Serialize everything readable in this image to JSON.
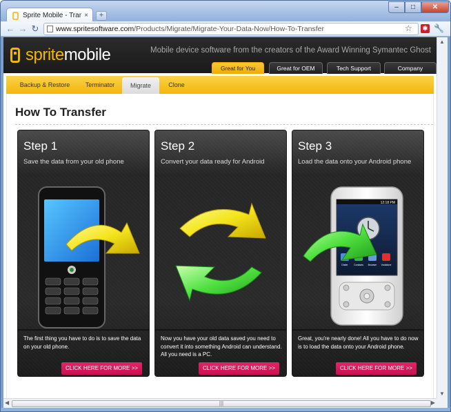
{
  "browser": {
    "tab_title": "Sprite Mobile - Transfer ...",
    "tab_close": "×",
    "new_tab": "+",
    "url_domain": "www.spritesoftware.com",
    "url_path": "/Products/Migrate/Migrate-Your-Data-Now/How-To-Transfer",
    "window_buttons": {
      "minimize": "–",
      "maximize": "□",
      "close": "✕"
    },
    "nav": {
      "back": "←",
      "forward": "→",
      "reload": "↻"
    },
    "star": "☆",
    "wrench": "🔧",
    "extension": "✱",
    "scroll_grip": "|||"
  },
  "site": {
    "logo_sprite": "sprite",
    "logo_mobile": "mobile",
    "tagline": "Mobile device software from the creators of the Award Winning Symantec Ghost",
    "top_tabs": [
      {
        "label": "Great for You"
      },
      {
        "label": "Great for OEM"
      },
      {
        "label": "Tech Support"
      },
      {
        "label": "Company"
      }
    ],
    "sub_nav": [
      {
        "label": "Backup & Restore"
      },
      {
        "label": "Terminator"
      },
      {
        "label": "Migrate"
      },
      {
        "label": "Clone"
      }
    ],
    "page_title": "How To Transfer"
  },
  "steps": [
    {
      "title": "Step 1",
      "subtitle": "Save the data from your old phone",
      "description": "The first thing you have to do is to save the data on your old phone.",
      "button": "CLICK HERE FOR MORE >>"
    },
    {
      "title": "Step 2",
      "subtitle": "Convert your data ready for Android",
      "description": "Now you have your old data saved you need to convert it into something Android can understand. All you need is a PC.",
      "button": "CLICK HERE FOR MORE >>"
    },
    {
      "title": "Step 3",
      "subtitle": "Load the data onto your Android phone",
      "description": "Great, you're nearly done! All you have to do now is to load the data onto your Android phone.",
      "button": "CLICK HERE FOR MORE >>"
    }
  ],
  "android_screen": {
    "time": "12:18 PM",
    "apps": [
      "Dialer",
      "Contacts",
      "Browser",
      "Vodafone"
    ]
  },
  "colors": {
    "accent_yellow": "#f3b60d",
    "button_pink": "#d8185a",
    "arrow_yellow": "#f3e21b",
    "arrow_green": "#3fd23a"
  }
}
